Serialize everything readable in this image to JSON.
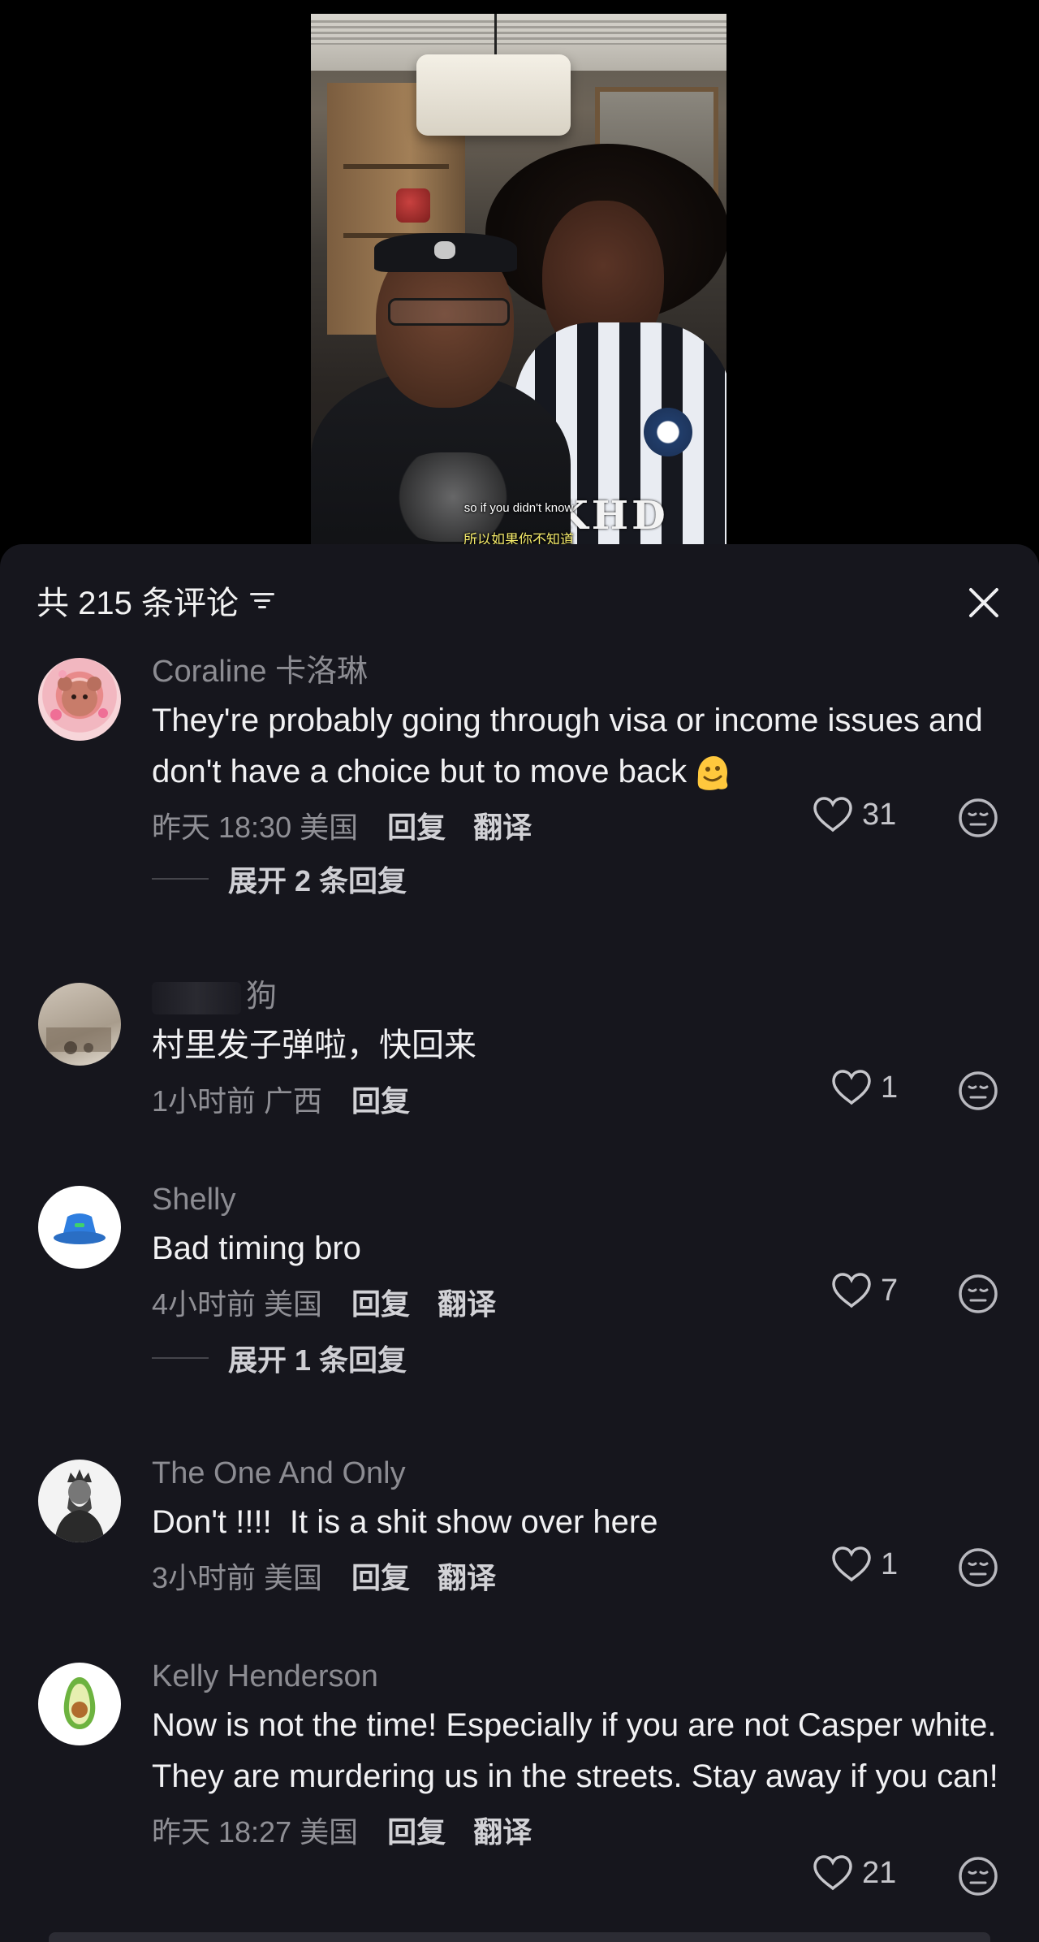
{
  "video": {
    "subtitle_en": "so if you didn't know",
    "subtitle_zh": "所以如果你不知道",
    "shirt_letters": "KHD"
  },
  "sheet": {
    "title": "共 215 条评论",
    "sort_icon": "filter-lines-icon",
    "close_icon": "close-icon"
  },
  "comments": [
    {
      "author": "Coraline 卡洛琳",
      "text": "They're probably going through visa or income issues and don't have a choice but to move back",
      "emoji": "melting-face",
      "time": "昨天 18:30 美国",
      "reply": "回复",
      "translate": "翻译",
      "likes": "31",
      "expand": "展开 2 条回复"
    },
    {
      "author": "狗",
      "text": "村里发子弹啦，快回来",
      "time": "1小时前 广西",
      "reply": "回复",
      "likes": "1"
    },
    {
      "author": "Shelly",
      "text": "Bad timing bro",
      "time": "4小时前 美国",
      "reply": "回复",
      "translate": "翻译",
      "likes": "7",
      "expand": "展开 1 条回复"
    },
    {
      "author": "The One And Only",
      "text": "Don't !!!!  It is a shit show over here",
      "time": "3小时前 美国",
      "reply": "回复",
      "translate": "翻译",
      "likes": "1"
    },
    {
      "author": "Kelly Henderson",
      "text": "Now is not the time! Especially if you are not Casper white. They are murdering us in the streets. Stay away if you can!",
      "time": "昨天 18:27 美国",
      "reply": "回复",
      "translate": "翻译",
      "likes": "21"
    }
  ],
  "colors": {
    "sheet_bg": "#16161d",
    "text_primary": "#f1f1f3",
    "text_secondary": "#8c8c92"
  }
}
